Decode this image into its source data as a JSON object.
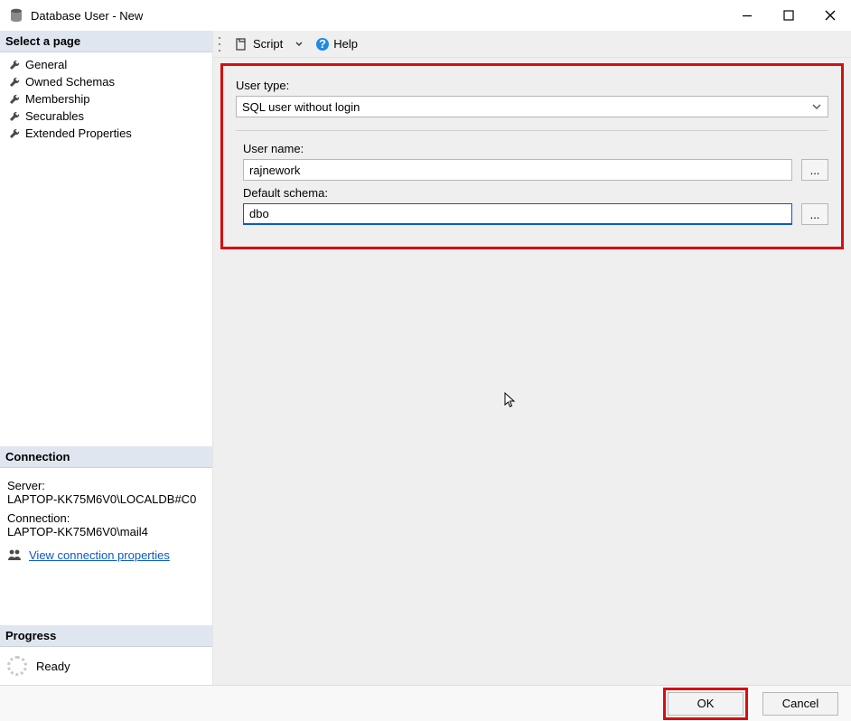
{
  "window": {
    "title": "Database User - New"
  },
  "sidebar": {
    "select_page": "Select a page",
    "pages": [
      {
        "label": "General"
      },
      {
        "label": "Owned Schemas"
      },
      {
        "label": "Membership"
      },
      {
        "label": "Securables"
      },
      {
        "label": "Extended Properties"
      }
    ],
    "connection_header": "Connection",
    "server_label": "Server:",
    "server_value": "LAPTOP-KK75M6V0\\LOCALDB#C0",
    "connection_label": "Connection:",
    "connection_value": "LAPTOP-KK75M6V0\\mail4",
    "view_conn_props": "View connection properties",
    "progress_header": "Progress",
    "progress_status": "Ready"
  },
  "toolbar": {
    "script_label": "Script",
    "help_label": "Help"
  },
  "form": {
    "user_type_label": "User type:",
    "user_type_value": "SQL user without login",
    "user_name_label": "User name:",
    "user_name_value": "rajnework",
    "default_schema_label": "Default schema:",
    "default_schema_value": "dbo",
    "browse_label": "..."
  },
  "footer": {
    "ok": "OK",
    "cancel": "Cancel"
  }
}
